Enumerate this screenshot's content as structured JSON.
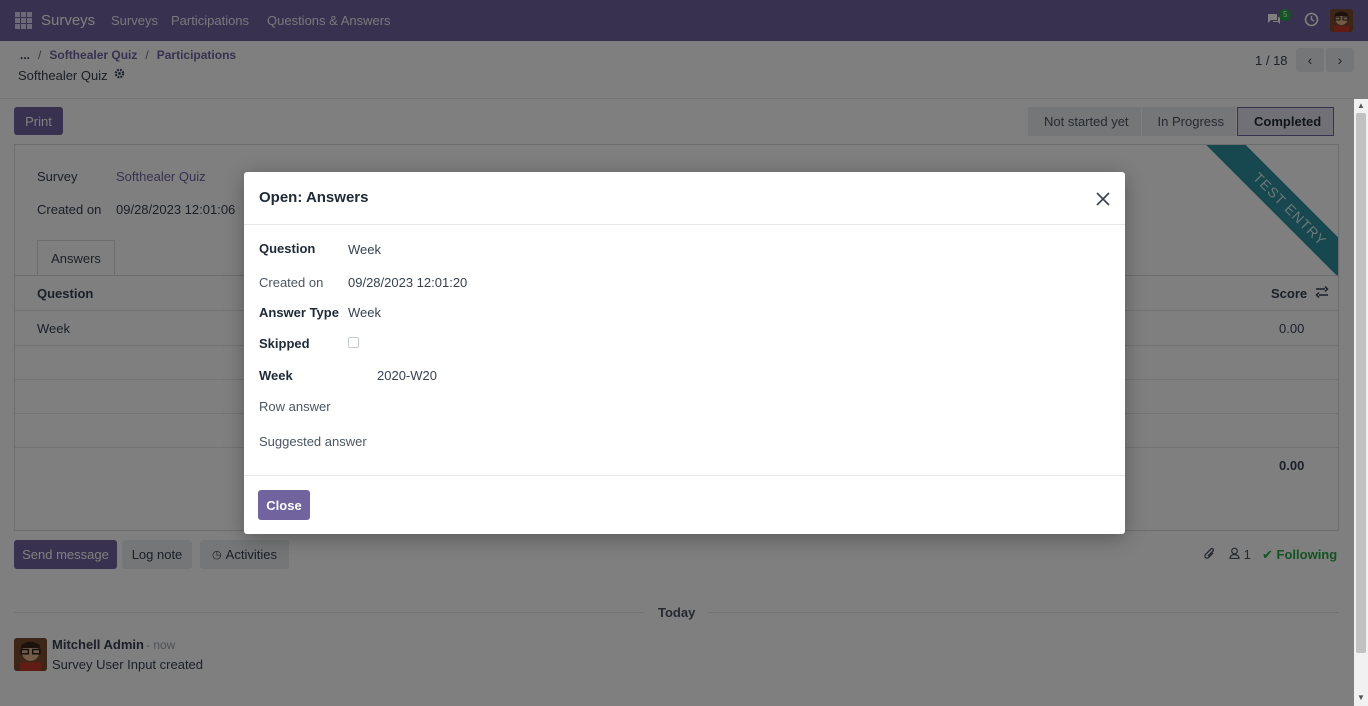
{
  "navbar": {
    "app_name": "Surveys",
    "menu": [
      "Surveys",
      "Participations",
      "Questions & Answers"
    ],
    "message_count": "5"
  },
  "breadcrumb": {
    "ellipsis": "...",
    "items": [
      "Softhealer Quiz",
      "Participations"
    ],
    "record": "Softhealer Quiz"
  },
  "pager": {
    "text": "1 / 18"
  },
  "actions": {
    "print": "Print"
  },
  "statusbar": {
    "stages": [
      "Not started yet",
      "In Progress",
      "Completed"
    ],
    "active": "Completed"
  },
  "form": {
    "survey_label": "Survey",
    "survey_value": "Softhealer Quiz",
    "created_label": "Created on",
    "created_value": "09/28/2023 12:01:06",
    "tab": "Answers",
    "ribbon": "TEST ENTRY",
    "columns": {
      "question": "Question",
      "score": "Score"
    },
    "rows": [
      {
        "question": "Week",
        "score": "0.00"
      }
    ],
    "total_score": "0.00"
  },
  "chatter": {
    "send_message": "Send message",
    "log_note": "Log note",
    "activities": "Activities",
    "followers": "1",
    "following": "Following",
    "date_separator": "Today",
    "message": {
      "author": "Mitchell Admin",
      "time": "- now",
      "body": "Survey User Input created"
    }
  },
  "modal": {
    "title": "Open: Answers",
    "fields": {
      "question_label": "Question",
      "question_value": "Week",
      "created_label": "Created on",
      "created_value": "09/28/2023 12:01:20",
      "answer_type_label": "Answer Type",
      "answer_type_value": "Week",
      "skipped_label": "Skipped",
      "week_label": "Week",
      "week_value": "2020-W20",
      "row_answer_label": "Row answer",
      "suggested_answer_label": "Suggested answer"
    },
    "close_button": "Close"
  },
  "colors": {
    "brand": "#71639e",
    "ribbon": "#2f8e9e",
    "success": "#28a745"
  }
}
